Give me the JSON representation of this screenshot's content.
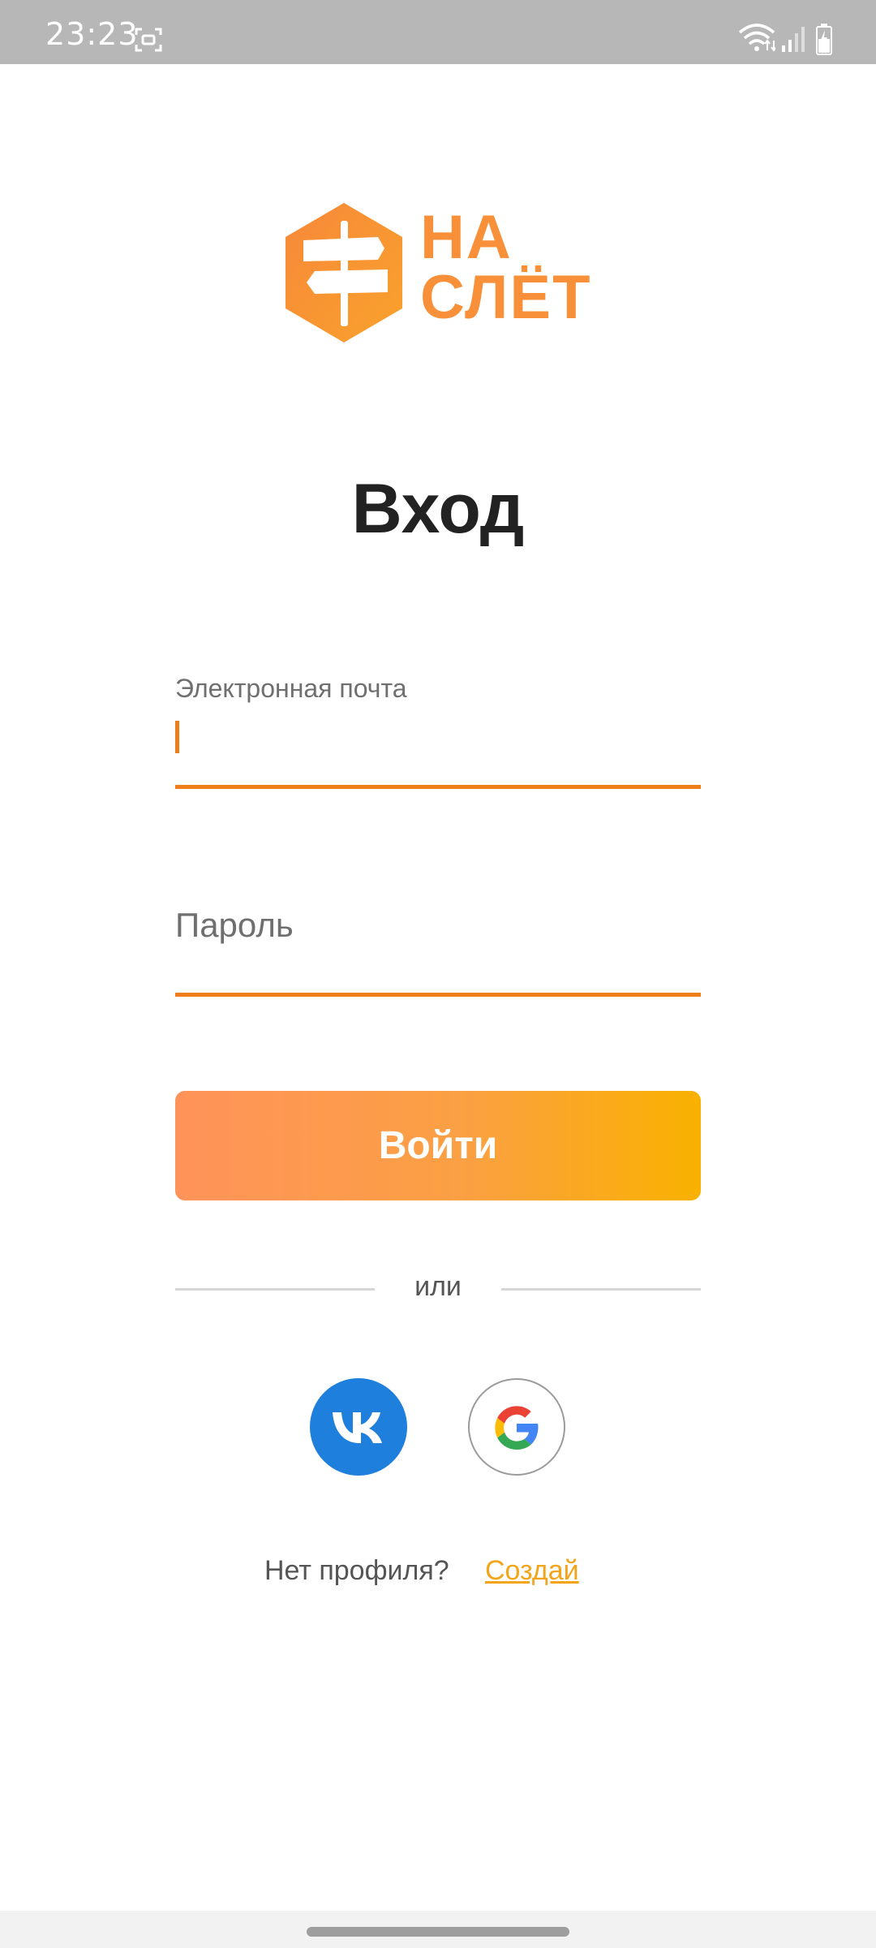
{
  "status_bar": {
    "time": "23:23",
    "icons": [
      "screenshot-icon",
      "wifi-icon",
      "signal-icon",
      "battery-icon"
    ]
  },
  "logo": {
    "line1": "НА",
    "line2": "СЛЁТ",
    "color": "#f8903a"
  },
  "title": "Вход",
  "email_field": {
    "label": "Электронная почта",
    "value": ""
  },
  "password_field": {
    "placeholder": "Пароль",
    "value": ""
  },
  "login_button": {
    "label": "Войти",
    "gradient": [
      "#ff935a",
      "#f9b100"
    ]
  },
  "divider_text": "или",
  "social": [
    "vk-icon",
    "google-icon"
  ],
  "register": {
    "prompt": "Нет профиля?",
    "link": "Создай"
  },
  "colors": {
    "accent": "#ef7d1a",
    "vk_blue": "#1f7fdc",
    "link": "#f2a51a"
  }
}
